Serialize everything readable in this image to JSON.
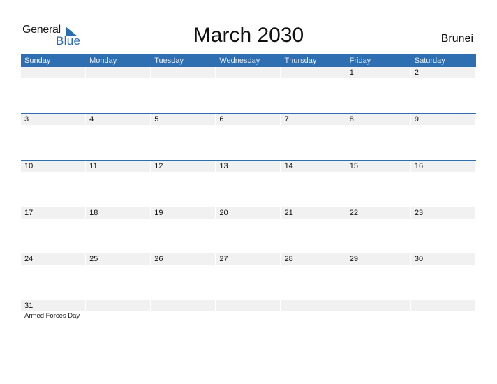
{
  "logo": {
    "line1": "General",
    "line2": "Blue"
  },
  "title": "March 2030",
  "country": "Brunei",
  "colors": {
    "accent": "#2e6fb2",
    "band": "#f1f1f1"
  },
  "weekdays": [
    "Sunday",
    "Monday",
    "Tuesday",
    "Wednesday",
    "Thursday",
    "Friday",
    "Saturday"
  ],
  "weeks": [
    [
      {
        "d": ""
      },
      {
        "d": ""
      },
      {
        "d": ""
      },
      {
        "d": ""
      },
      {
        "d": ""
      },
      {
        "d": "1"
      },
      {
        "d": "2"
      }
    ],
    [
      {
        "d": "3"
      },
      {
        "d": "4"
      },
      {
        "d": "5"
      },
      {
        "d": "6"
      },
      {
        "d": "7"
      },
      {
        "d": "8"
      },
      {
        "d": "9"
      }
    ],
    [
      {
        "d": "10"
      },
      {
        "d": "11"
      },
      {
        "d": "12"
      },
      {
        "d": "13"
      },
      {
        "d": "14"
      },
      {
        "d": "15"
      },
      {
        "d": "16"
      }
    ],
    [
      {
        "d": "17"
      },
      {
        "d": "18"
      },
      {
        "d": "19"
      },
      {
        "d": "20"
      },
      {
        "d": "21"
      },
      {
        "d": "22"
      },
      {
        "d": "23"
      }
    ],
    [
      {
        "d": "24"
      },
      {
        "d": "25"
      },
      {
        "d": "26"
      },
      {
        "d": "27"
      },
      {
        "d": "28"
      },
      {
        "d": "29"
      },
      {
        "d": "30"
      }
    ],
    [
      {
        "d": "31",
        "holiday": "Armed Forces Day"
      }
    ]
  ]
}
